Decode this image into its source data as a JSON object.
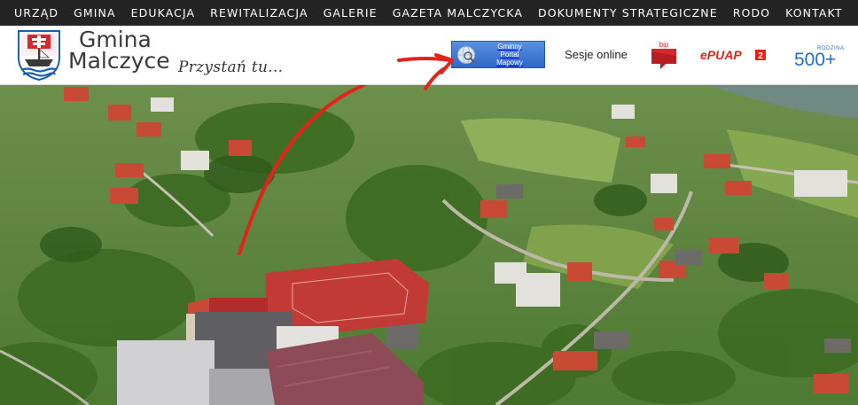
{
  "nav": {
    "items": [
      {
        "label": "URZĄD"
      },
      {
        "label": "GMINA"
      },
      {
        "label": "EDUKACJA"
      },
      {
        "label": "REWITALIZACJA"
      },
      {
        "label": "GALERIE"
      },
      {
        "label": "GAZETA MALCZYCKA"
      },
      {
        "label": "DOKUMENTY STRATEGICZNE"
      },
      {
        "label": "RODO"
      },
      {
        "label": "KONTAKT"
      }
    ]
  },
  "header": {
    "brand_line1": "Gmina",
    "brand_line2": "Malczyce",
    "slogan": "Przystań tu...",
    "gpm_line1": "Gminny",
    "gpm_line2": "Portal",
    "gpm_line3": "Mapowy",
    "sesje_label": "Sesje online",
    "bip_label": "bip",
    "epuap_label": "ePUAP",
    "epuap_number": "2",
    "program_label": "500+",
    "program_small": "RODZINA"
  },
  "colors": {
    "nav_bg": "#242424",
    "crest_blue": "#1a5fb0",
    "crest_red": "#d9252b",
    "bip_red": "#d9252b",
    "epuap_red": "#e2231a",
    "program_blue": "#1f6fc9",
    "gpm_blue": "#2f67c9",
    "arrow_red": "#e2231a",
    "roof_red": "#c84a34",
    "field_green": "#5f8f3a"
  },
  "icons": {
    "crest": "municipal-crest-icon",
    "globe": "globe-search-icon",
    "arrow": "red-arrow-annotation"
  }
}
